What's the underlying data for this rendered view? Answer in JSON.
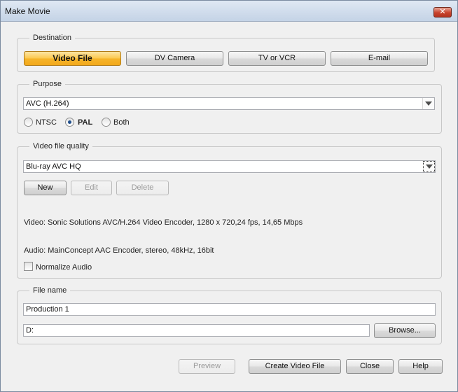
{
  "window": {
    "title": "Make Movie",
    "close_glyph": "✕"
  },
  "destination": {
    "label": "Destination",
    "buttons": [
      "Video File",
      "DV Camera",
      "TV or VCR",
      "E-mail"
    ],
    "selected": "Video File"
  },
  "purpose": {
    "label": "Purpose",
    "format_value": "AVC (H.264)",
    "tv_options": [
      "NTSC",
      "PAL",
      "Both"
    ],
    "tv_selected": "PAL"
  },
  "quality": {
    "label": "Video file quality",
    "preset_value": "Blu-ray AVC HQ",
    "buttons": {
      "new": "New",
      "edit": "Edit",
      "delete": "Delete"
    },
    "video_info": "Video: Sonic Solutions AVC/H.264 Video Encoder, 1280 x 720,24 fps, 14,65 Mbps",
    "audio_info": "Audio: MainConcept AAC Encoder, stereo, 48kHz, 16bit",
    "normalize_label": "Normalize Audio",
    "normalize_checked": false
  },
  "file": {
    "label": "File name",
    "name_value": "Production 1",
    "path_value": "D:",
    "browse_label": "Browse..."
  },
  "footer": {
    "preview": "Preview",
    "create": "Create Video File",
    "close": "Close",
    "help": "Help"
  }
}
